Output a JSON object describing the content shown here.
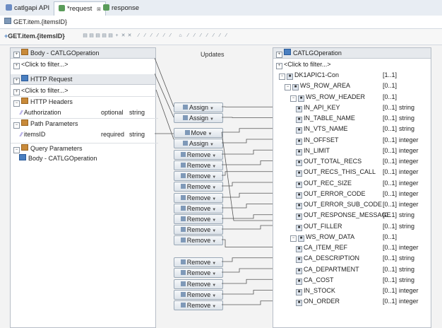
{
  "tabs": [
    {
      "label": "catlgapi API",
      "icon_color": "#6b8cc4",
      "active": false
    },
    {
      "label": "*request",
      "icon_color": "#5a9c5a",
      "active": true,
      "close": "⊠"
    },
    {
      "label": "response",
      "icon_color": "#5a9c5a",
      "active": false
    }
  ],
  "path_label": "GET.item.{itemsID}",
  "toolbar_title": "GET.item.{itemsID}",
  "updates_label": "Updates",
  "left_panel": {
    "title": "Body - CATLGOperation",
    "filter": "<Click to filter...>",
    "http_request": "HTTP Request",
    "filter2": "<Click to filter...>",
    "sections": [
      {
        "label": "HTTP Headers",
        "rows": [
          {
            "name": "Authorization",
            "qual": "optional",
            "type": "string"
          }
        ]
      },
      {
        "label": "Path Parameters",
        "rows": [
          {
            "name": "itemsID",
            "qual": "required",
            "type": "string"
          }
        ]
      },
      {
        "label": "Query Parameters",
        "rows": []
      }
    ],
    "body_row": "Body - CATLGOperation"
  },
  "right_panel": {
    "title": "CATLGOperation",
    "filter": "<Click to filter...>",
    "rows": [
      {
        "name": "DK1APIC1-Con",
        "card": "[1..1]",
        "type": "",
        "indent": 0,
        "group": true
      },
      {
        "name": "WS_ROW_AREA",
        "card": "[0..1]",
        "type": "",
        "indent": 1,
        "group": true
      },
      {
        "name": "WS_ROW_HEADER",
        "card": "[0..1]",
        "type": "",
        "indent": 2,
        "group": true
      },
      {
        "name": "IN_API_KEY",
        "card": "[0..1]",
        "type": "string",
        "indent": 3
      },
      {
        "name": "IN_TABLE_NAME",
        "card": "[0..1]",
        "type": "string",
        "indent": 3
      },
      {
        "name": "IN_VTS_NAME",
        "card": "[0..1]",
        "type": "string",
        "indent": 3
      },
      {
        "name": "IN_OFFSET",
        "card": "[0..1]",
        "type": "integer",
        "indent": 3
      },
      {
        "name": "IN_LIMIT",
        "card": "[0..1]",
        "type": "integer",
        "indent": 3
      },
      {
        "name": "OUT_TOTAL_RECS",
        "card": "[0..1]",
        "type": "integer",
        "indent": 3
      },
      {
        "name": "OUT_RECS_THIS_CALL",
        "card": "[0..1]",
        "type": "integer",
        "indent": 3
      },
      {
        "name": "OUT_REC_SIZE",
        "card": "[0..1]",
        "type": "integer",
        "indent": 3
      },
      {
        "name": "OUT_ERROR_CODE",
        "card": "[0..1]",
        "type": "integer",
        "indent": 3
      },
      {
        "name": "OUT_ERROR_SUB_CODE",
        "card": "[0..1]",
        "type": "integer",
        "indent": 3
      },
      {
        "name": "OUT_RESPONSE_MESSAGE",
        "card": "[0..1]",
        "type": "string",
        "indent": 3
      },
      {
        "name": "OUT_FILLER",
        "card": "[0..1]",
        "type": "string",
        "indent": 3
      },
      {
        "name": "WS_ROW_DATA",
        "card": "[0..1]",
        "type": "",
        "indent": 2,
        "group": true
      },
      {
        "name": "CA_ITEM_REF",
        "card": "[0..1]",
        "type": "integer",
        "indent": 3
      },
      {
        "name": "CA_DESCRIPTION",
        "card": "[0..1]",
        "type": "string",
        "indent": 3
      },
      {
        "name": "CA_DEPARTMENT",
        "card": "[0..1]",
        "type": "string",
        "indent": 3
      },
      {
        "name": "CA_COST",
        "card": "[0..1]",
        "type": "string",
        "indent": 3
      },
      {
        "name": "IN_STOCK",
        "card": "[0..1]",
        "type": "integer",
        "indent": 3
      },
      {
        "name": "ON_ORDER",
        "card": "[0..1]",
        "type": "integer",
        "indent": 3
      }
    ]
  },
  "transforms": [
    "Assign",
    "Assign",
    "Move",
    "Assign",
    "Remove",
    "Remove",
    "Remove",
    "Remove",
    "Remove",
    "Remove",
    "Remove",
    "Remove",
    "Remove",
    "Remove",
    "Remove",
    "Remove",
    "Remove",
    "Remove"
  ]
}
